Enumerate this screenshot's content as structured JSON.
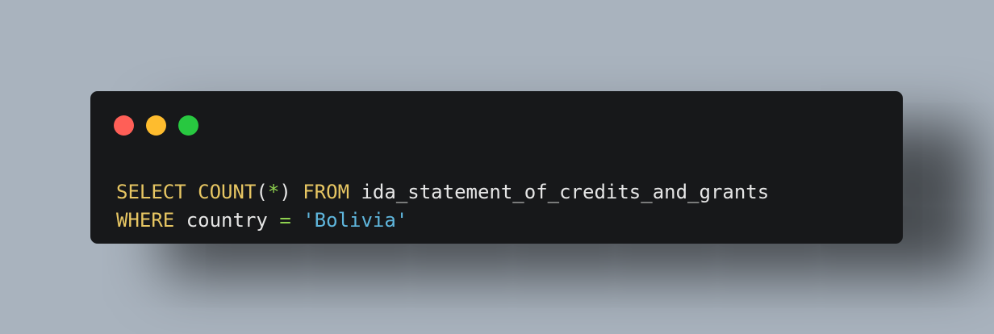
{
  "window": {
    "controls": [
      "close",
      "minimize",
      "maximize"
    ]
  },
  "code": {
    "line1": {
      "select": "SELECT",
      "count": "COUNT",
      "open_paren": "(",
      "star": "*",
      "close_paren": ")",
      "from": "FROM",
      "table": "ida_statement_of_credits_and_grants"
    },
    "line2": {
      "where": "WHERE",
      "column": "country",
      "equals": "=",
      "value": "'Bolivia'"
    }
  },
  "colors": {
    "background": "#a9b3be",
    "window": "#17181a",
    "keyword": "#e7c663",
    "operator": "#8fd14f",
    "string": "#5fb6dd",
    "text": "#e6e6e6",
    "close": "#ff5f57",
    "minimize": "#febc2e",
    "maximize": "#28c840"
  }
}
